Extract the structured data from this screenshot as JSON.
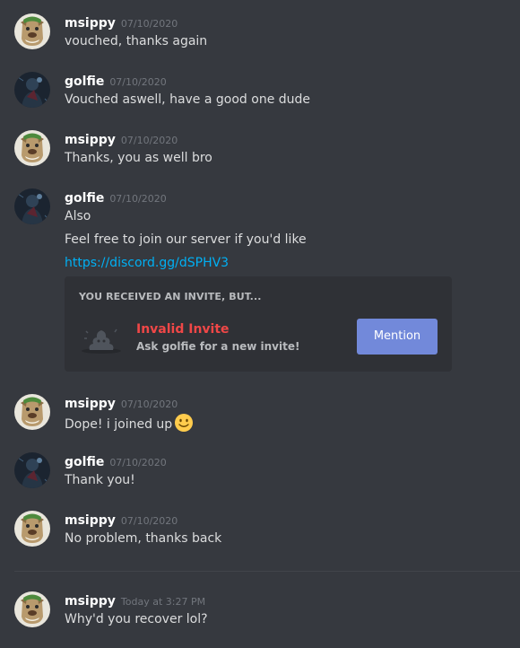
{
  "colors": {
    "background": "#36393f",
    "embed_background": "#2f3136",
    "username": "#ffffff",
    "timestamp": "#72767d",
    "text": "#dcddde",
    "link": "#00b0f4",
    "invalid": "#f04747",
    "button": "#7289da"
  },
  "messages": [
    {
      "user": "msippy",
      "time": "07/10/2020",
      "avatar": "bulldog-avatar",
      "lines": [
        "vouched, thanks again"
      ]
    },
    {
      "user": "golfie",
      "time": "07/10/2020",
      "avatar": "dark-figure-avatar",
      "lines": [
        "Vouched aswell, have a good one dude"
      ]
    },
    {
      "user": "msippy",
      "time": "07/10/2020",
      "avatar": "bulldog-avatar",
      "lines": [
        "Thanks, you as well bro"
      ]
    },
    {
      "user": "golfie",
      "time": "07/10/2020",
      "avatar": "dark-figure-avatar",
      "lines": [
        "Also",
        "Feel free to join our server if you'd like"
      ],
      "link": "https://discord.gg/dSPHV3"
    },
    {
      "user": "msippy",
      "time": "07/10/2020",
      "avatar": "bulldog-avatar",
      "lines": [
        "Dope! i joined up"
      ],
      "emoji": "slightly-smiling-face"
    },
    {
      "user": "golfie",
      "time": "07/10/2020",
      "avatar": "dark-figure-avatar",
      "lines": [
        "Thank you!"
      ]
    },
    {
      "user": "msippy",
      "time": "07/10/2020",
      "avatar": "bulldog-avatar",
      "lines": [
        "No problem, thanks back"
      ]
    },
    {
      "user": "msippy",
      "time": "Today at 3:27 PM",
      "avatar": "bulldog-avatar",
      "lines": [
        "Why'd you recover lol?"
      ]
    }
  ],
  "invite": {
    "heading": "YOU RECEIVED AN INVITE, BUT...",
    "title": "Invalid Invite",
    "subtitle": "Ask golfie for a new invite!",
    "button_label": "Mention",
    "icon": "poop-icon"
  }
}
